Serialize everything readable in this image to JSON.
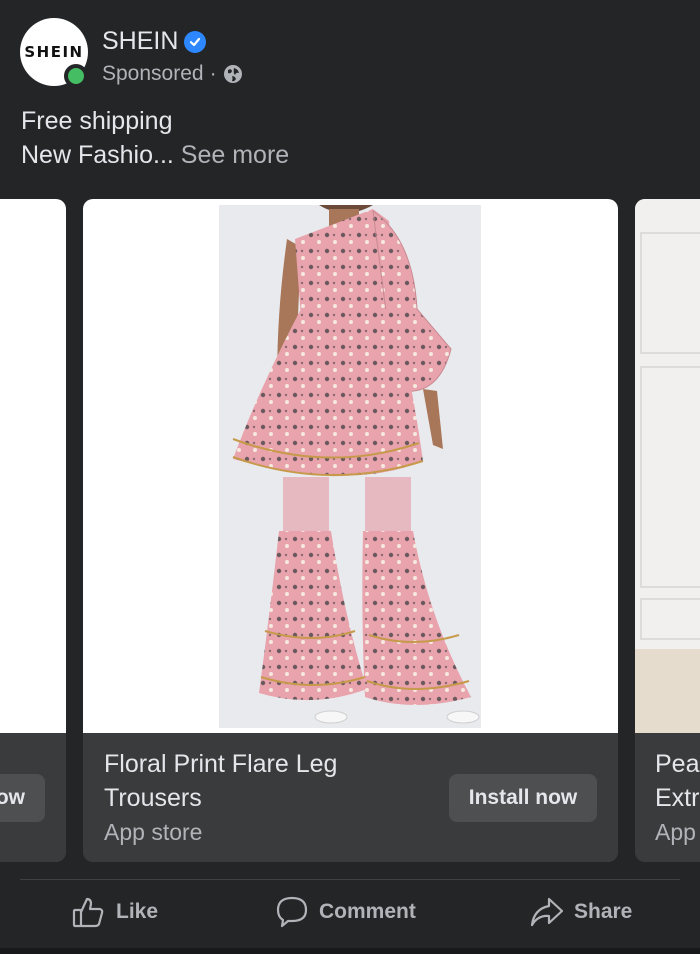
{
  "header": {
    "avatar_text": "SHEIN",
    "page_name": "SHEIN",
    "sponsored_label": "Sponsored",
    "separator": "·"
  },
  "post": {
    "line1": "Free shipping",
    "line2": "New Fashio...",
    "see_more": "See more"
  },
  "carousel": {
    "left_card": {
      "button_label_partial": "ow"
    },
    "main_card": {
      "title": "Floral Print Flare Leg Trousers",
      "subtitle": "App store",
      "button_label": "Install now"
    },
    "right_card": {
      "title_line1": "Pea",
      "title_line2": "Extr",
      "subtitle": "App"
    }
  },
  "actions": {
    "like": "Like",
    "comment": "Comment",
    "share": "Share"
  },
  "colors": {
    "background": "#242526",
    "card": "#3a3b3c",
    "button": "#4e4f50",
    "verified": "#2d88ff",
    "online": "#45bd62",
    "dress_pink": "#e8a3ad"
  }
}
